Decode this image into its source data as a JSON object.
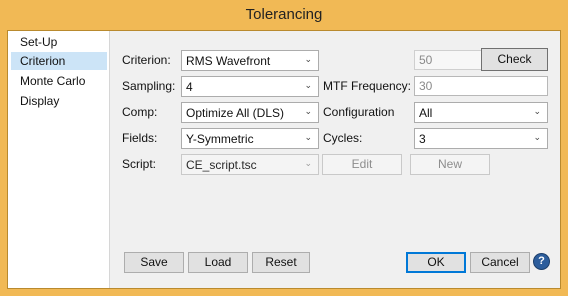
{
  "window": {
    "title": "Tolerancing"
  },
  "sidebar": {
    "items": [
      {
        "label": "Set-Up"
      },
      {
        "label": "Criterion"
      },
      {
        "label": "Monte Carlo"
      },
      {
        "label": "Display"
      }
    ],
    "selected": "Criterion"
  },
  "form": {
    "criterion": {
      "label": "Criterion:",
      "value": "RMS Wavefront"
    },
    "criterion_count": {
      "value": "50"
    },
    "check_button": "Check",
    "sampling": {
      "label": "Sampling:",
      "value": "4"
    },
    "mtf_frequency": {
      "label": "MTF Frequency:",
      "value": "30"
    },
    "comp": {
      "label": "Comp:",
      "value": "Optimize All (DLS)"
    },
    "configuration": {
      "label": "Configuration",
      "value": "All"
    },
    "fields": {
      "label": "Fields:",
      "value": "Y-Symmetric"
    },
    "cycles": {
      "label": "Cycles:",
      "value": "3"
    },
    "script": {
      "label": "Script:",
      "value": "CE_script.tsc"
    },
    "edit_button": "Edit",
    "new_button": "New"
  },
  "footer": {
    "save": "Save",
    "load": "Load",
    "reset": "Reset",
    "ok": "OK",
    "cancel": "Cancel",
    "help": "?"
  },
  "colors": {
    "titlebar": "#f1b955",
    "selection": "#cce4f7",
    "default_button_border": "#0078d7"
  }
}
